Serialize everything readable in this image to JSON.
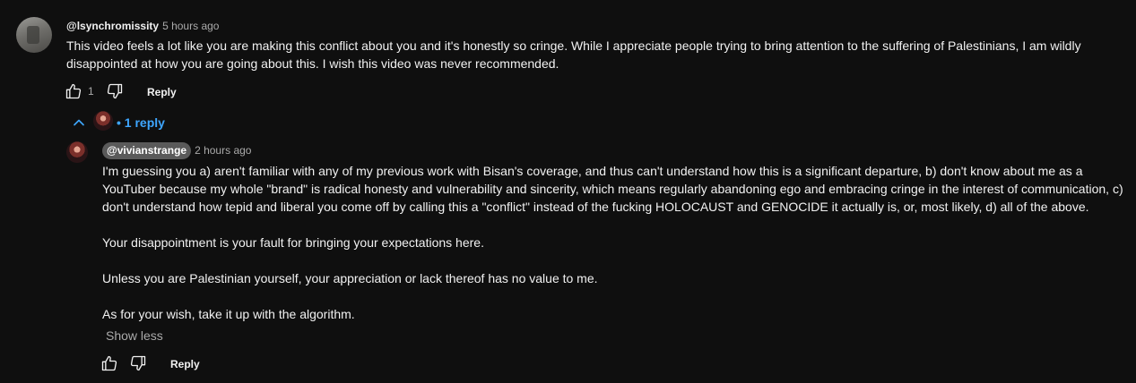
{
  "comment": {
    "author": "@lsynchromissity",
    "time": "5 hours ago",
    "text": "This video feels a lot like you are making this conflict about you and it's honestly so cringe. While I appreciate people trying to bring attention to the suffering of Palestinians, I am wildly disappointed at how you are going about this. I wish this video was never recommended.",
    "like_count": "1",
    "reply_label": "Reply"
  },
  "replies": {
    "toggle_label": "• 1 reply"
  },
  "reply": {
    "author": "@vivianstrange",
    "time": "2 hours ago",
    "paragraphs": [
      "I'm guessing you a) aren't familiar with any of my previous work with Bisan's coverage, and thus can't understand how this is a significant departure, b) don't know about me as a YouTuber because my whole \"brand\" is radical honesty and vulnerability and sincerity, which means regularly abandoning ego and embracing cringe in the interest of communication, c) don't understand how tepid and liberal you come off by calling this a \"conflict\" instead of the fucking HOLOCAUST and GENOCIDE it actually is, or, most likely, d) all of the above.",
      "Your disappointment is your fault for bringing your expectations here.",
      "Unless you are Palestinian yourself, your appreciation or lack thereof has no value to me.",
      "As for your wish, take it up with the algorithm."
    ],
    "show_less_label": "Show less",
    "reply_label": "Reply"
  },
  "icons": {
    "like": "thumbs-up-icon",
    "dislike": "thumbs-down-icon",
    "collapse": "chevron-up-icon"
  },
  "colors": {
    "background": "#0f0f0f",
    "link": "#3ea6ff",
    "secondary_text": "#aaaaaa"
  }
}
